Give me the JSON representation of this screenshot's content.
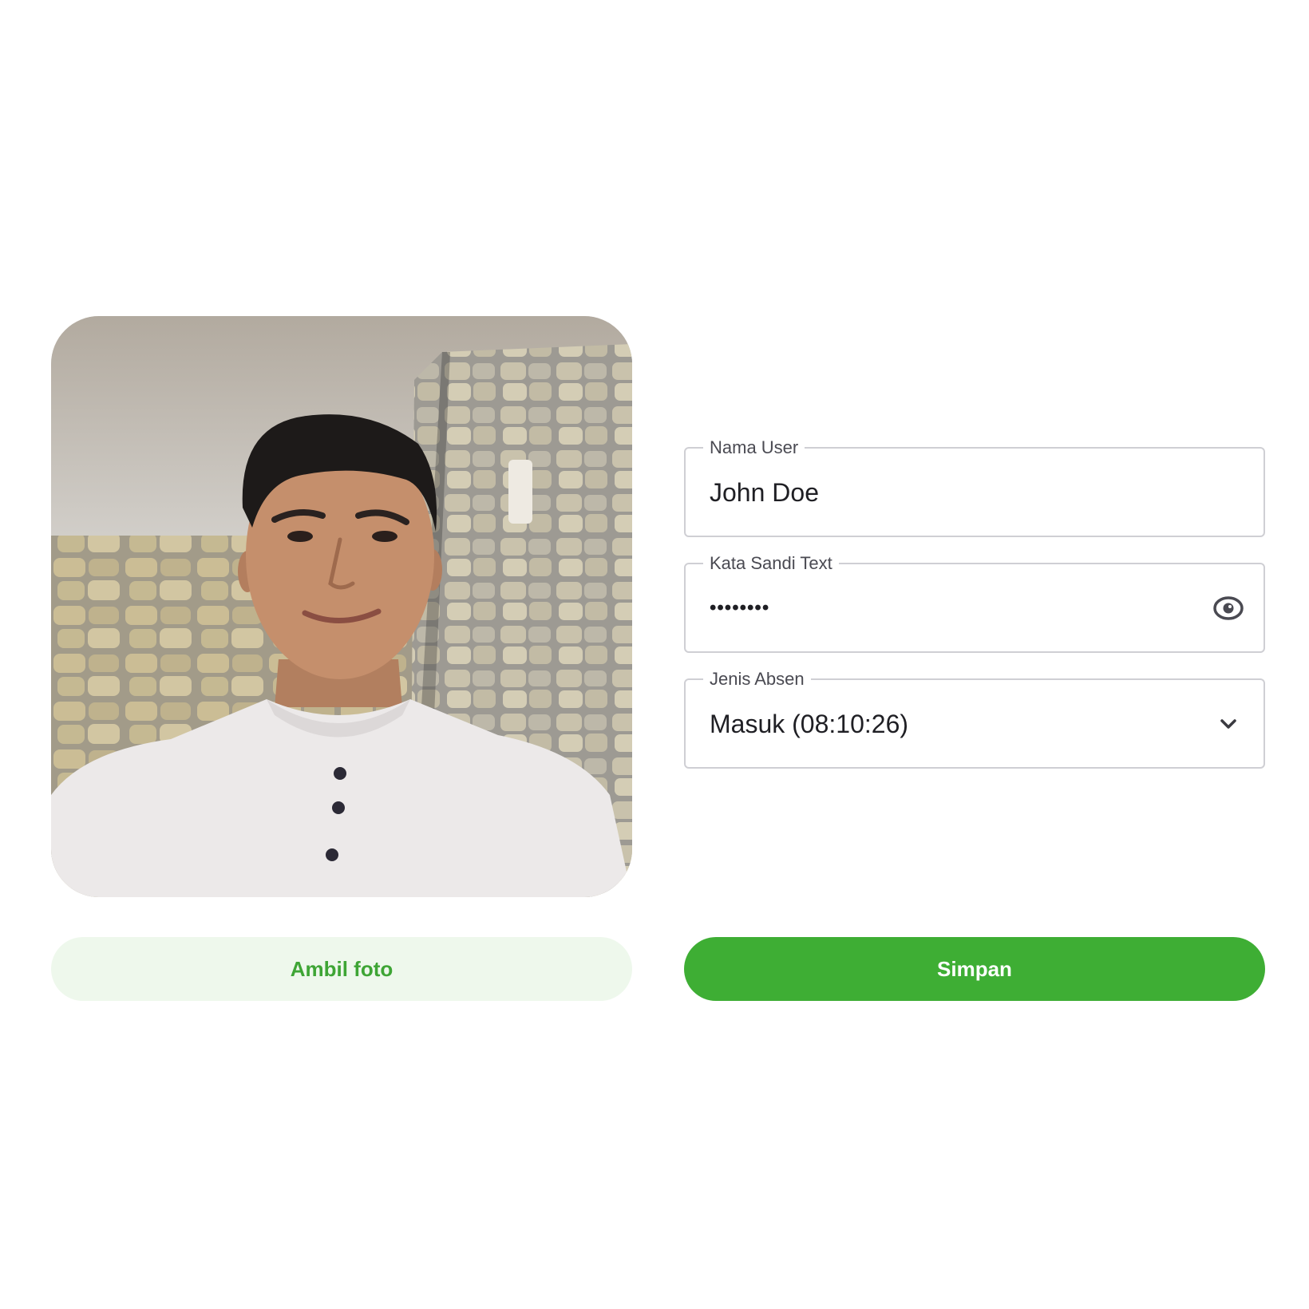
{
  "form": {
    "nama_user": {
      "label": "Nama User",
      "value": "John Doe"
    },
    "kata_sandi": {
      "label": "Kata Sandi Text",
      "value": "••••••••",
      "toggle_icon": "eye-icon"
    },
    "jenis_absen": {
      "label": "Jenis Absen",
      "selected": "Masuk (08:10:26)",
      "dropdown_icon": "chevron-down-icon"
    }
  },
  "actions": {
    "ambil_foto_label": "Ambil foto",
    "simpan_label": "Simpan"
  },
  "colors": {
    "primary": "#3eae34",
    "primary_light": "#eef8ec",
    "border": "#cfcfd4",
    "text": "#1f1f24",
    "label": "#4a4a52"
  }
}
